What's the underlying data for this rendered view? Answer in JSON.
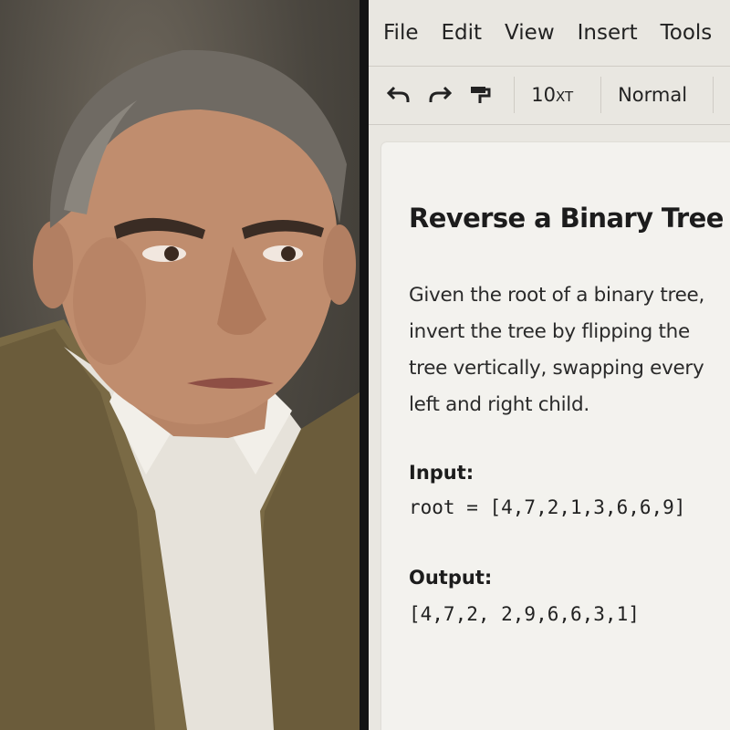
{
  "menu": {
    "items": [
      "File",
      "Edit",
      "View",
      "Insert",
      "Tools"
    ]
  },
  "toolbar": {
    "font_size": "10",
    "font_size_suffix": "XT",
    "style": "Normal",
    "icons": [
      "undo-icon",
      "redo-icon",
      "paint-format-icon"
    ]
  },
  "document": {
    "title": "Reverse a Binary Tree",
    "description_lines": [
      "Given the root of a binary tree,",
      "invert the tree by flipping the",
      "tree vertically, swapping every",
      "left and right child."
    ],
    "input_label": "Input:",
    "input_code": "root = [4,7,2,1,3,6,6,9]",
    "output_label": "Output:",
    "output_code": "[4,7,2, 2,9,6,6,3,1]"
  },
  "colors": {
    "doc_background": "#e9e7e1",
    "page_background": "#f3f2ee",
    "text": "#222222"
  }
}
